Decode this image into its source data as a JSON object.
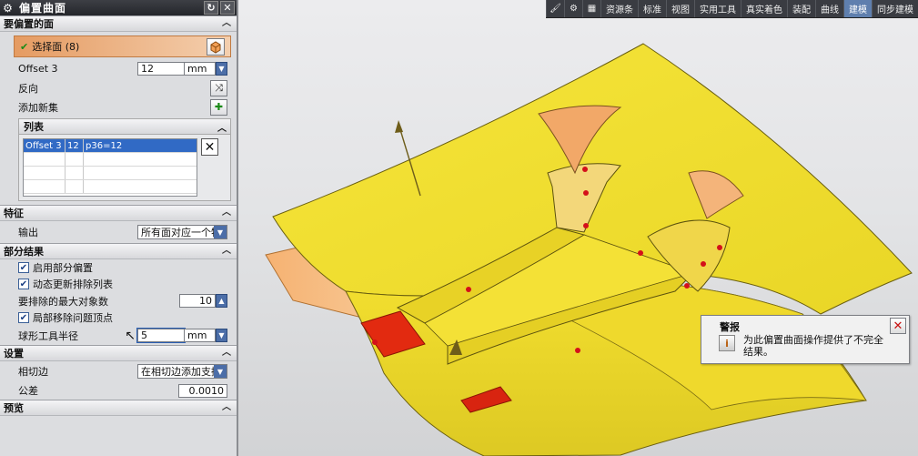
{
  "dialog": {
    "title": "偏置曲面",
    "sections": {
      "faces": {
        "header": "要偏置的面",
        "select_label": "选择面 (8)",
        "offset_label": "Offset 3",
        "offset_value": "12",
        "offset_unit": "mm",
        "reverse_label": "反向",
        "add_set_label": "添加新集",
        "list": {
          "header": "列表",
          "rows": [
            [
              "Offset 3",
              "12",
              "p36=12"
            ],
            [
              "",
              "",
              ""
            ],
            [
              "",
              "",
              ""
            ],
            [
              "",
              "",
              ""
            ]
          ]
        }
      },
      "feature": {
        "header": "特征",
        "output_label": "输出",
        "output_value": "所有面对应一个特"
      },
      "partial": {
        "header": "部分结果",
        "enable_label": "启用部分偏置",
        "dynamic_label": "动态更新排除列表",
        "max_exclude_label": "要排除的最大对象数",
        "max_exclude_value": "10",
        "local_remove_label": "局部移除问题顶点",
        "ball_radius_label": "球形工具半径",
        "ball_radius_value": "5",
        "ball_radius_unit": "mm"
      },
      "settings": {
        "header": "设置",
        "tangent_label": "相切边",
        "tangent_value": "在相切边添加支撑",
        "tolerance_label": "公差",
        "tolerance_value": "0.0010"
      },
      "preview": {
        "header": "预览"
      }
    }
  },
  "ribbon": {
    "tabs": [
      "资源条",
      "标准",
      "视图",
      "实用工具",
      "真实着色",
      "装配",
      "曲线",
      "建模",
      "同步建模"
    ],
    "active": "建模"
  },
  "warning": {
    "title": "警报",
    "message": "为此偏置曲面操作提供了不完全结果。"
  },
  "colors": {
    "surface": "#f2e12a",
    "surface_dark": "#c8b81a",
    "orange": "#f0a060",
    "red": "#e0280e",
    "accent": "#4c6ea8"
  }
}
